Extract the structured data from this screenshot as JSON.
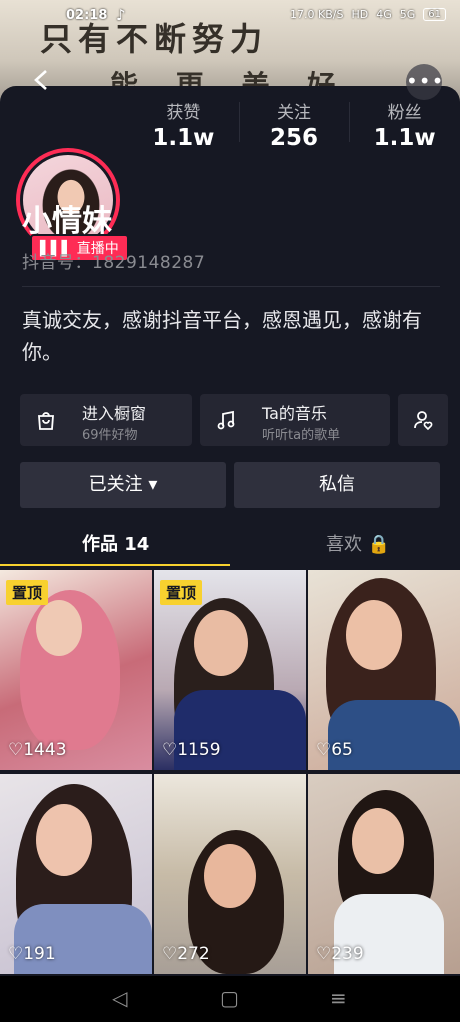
{
  "status_bar": {
    "time": "02:18",
    "network_speed": "17.0",
    "network_unit": "KB/S",
    "hd_label": "HD",
    "signal_1": "4G",
    "signal_2": "5G",
    "battery": "61"
  },
  "header_background_text": {
    "line1": "只有不断努力",
    "line2": "能 更 美 好"
  },
  "profile": {
    "live_badge": "直播中",
    "stats": [
      {
        "label": "获赞",
        "value": "1.1w"
      },
      {
        "label": "关注",
        "value": "256"
      },
      {
        "label": "粉丝",
        "value": "1.1w"
      }
    ],
    "name": "小情妹",
    "douyin_id": "抖音号：1829148287",
    "bio": "真诚交友，感谢抖音平台，感恩遇见，感谢有你。"
  },
  "tiles": {
    "shop": {
      "title": "进入橱窗",
      "subtitle": "69件好物"
    },
    "music": {
      "title": "Ta的音乐",
      "subtitle": "听听ta的歌单"
    }
  },
  "buttons": {
    "followed": "已关注 ▾",
    "message": "私信"
  },
  "tabs": {
    "works": "作品 14",
    "likes": "喜欢 🔒"
  },
  "videos": [
    {
      "pinned": "置顶",
      "likes": "♡1443"
    },
    {
      "pinned": "置顶",
      "likes": "♡1159"
    },
    {
      "pinned": "",
      "likes": "♡65"
    },
    {
      "pinned": "",
      "likes": "♡191"
    },
    {
      "pinned": "",
      "likes": "♡272"
    },
    {
      "pinned": "",
      "likes": "♡239"
    }
  ],
  "colors": {
    "background": "#161823",
    "accent_live": "#fe2c55",
    "pin_yellow": "#f8d12f"
  }
}
